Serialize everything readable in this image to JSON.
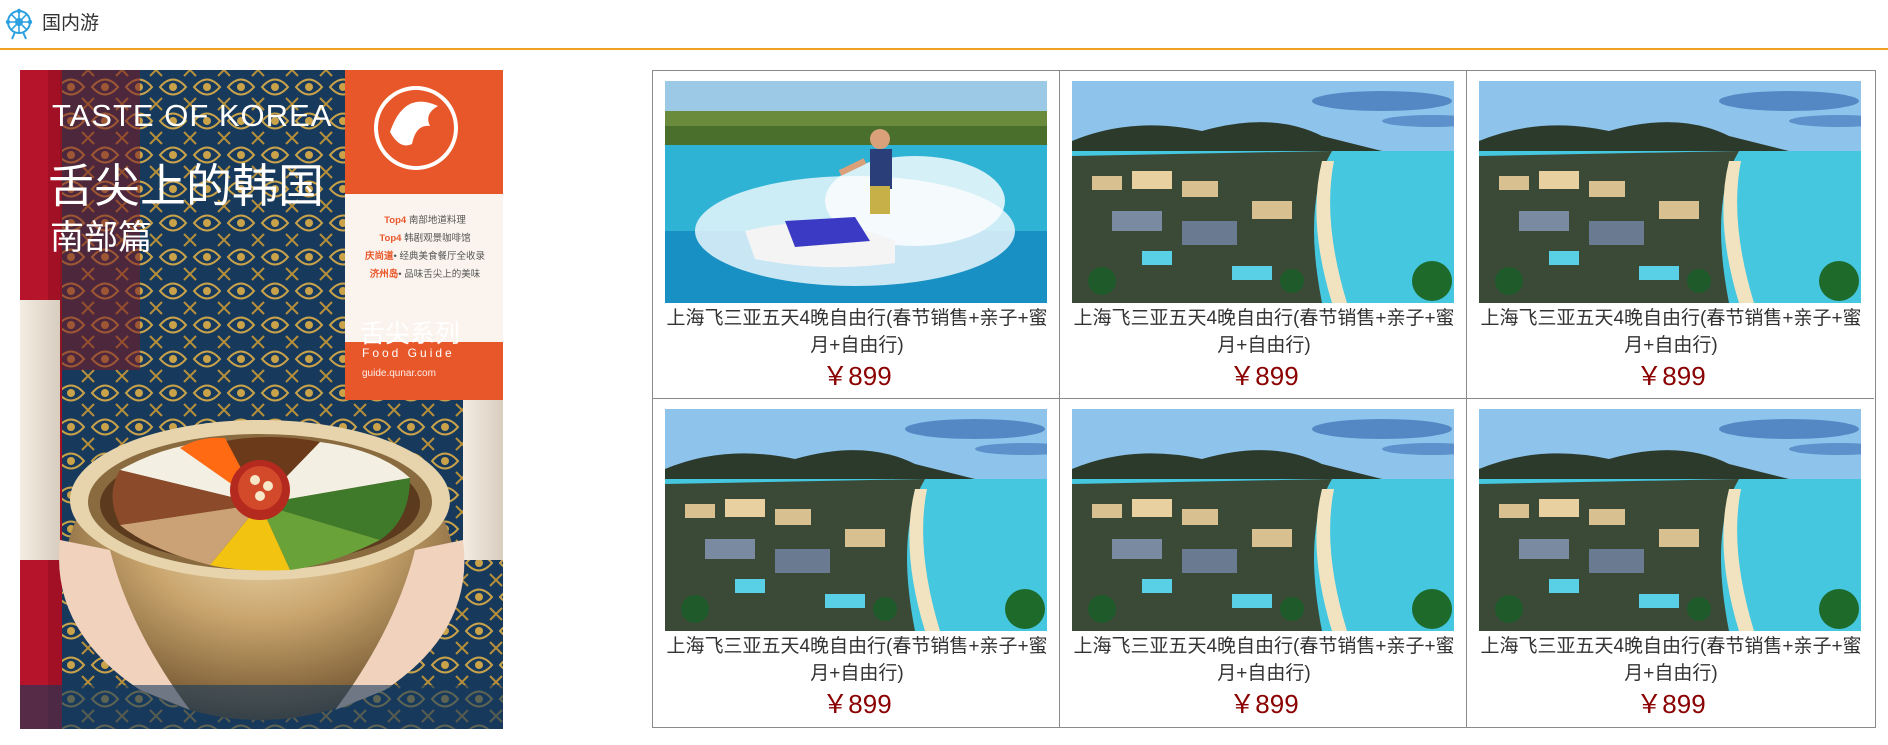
{
  "header": {
    "title": "国内游",
    "accent_color": "#f0a020",
    "logo_icon": "ferris-wheel-icon"
  },
  "banner": {
    "headline_en": "TASTE OF KOREA",
    "headline_cn": "舌尖上的韩国",
    "subtitle": "南部篇",
    "lines": [
      {
        "tag": "Top4",
        "text": "南部地道料理"
      },
      {
        "tag": "Top4",
        "text": "韩剧观景咖啡馆"
      },
      {
        "tag": "庆尚道",
        "text": "• 经典美食餐厅全收录"
      },
      {
        "tag": "济州岛",
        "text": "• 品味舌尖上的美味"
      }
    ],
    "series_cn": "舌尖系列",
    "series_en": "Food Guide",
    "url": "guide.qunar.com",
    "brand_color": "#e8572a"
  },
  "products": [
    {
      "name": "上海飞三亚五天4晚自由行(春节销售+亲子+蜜月+自由行)",
      "price": "￥899",
      "image": "jetski"
    },
    {
      "name": "上海飞三亚五天4晚自由行(春节销售+亲子+蜜月+自由行)",
      "price": "￥899",
      "image": "resort"
    },
    {
      "name": "上海飞三亚五天4晚自由行(春节销售+亲子+蜜月+自由行)",
      "price": "￥899",
      "image": "resort"
    },
    {
      "name": "上海飞三亚五天4晚自由行(春节销售+亲子+蜜月+自由行)",
      "price": "￥899",
      "image": "resort"
    },
    {
      "name": "上海飞三亚五天4晚自由行(春节销售+亲子+蜜月+自由行)",
      "price": "￥899",
      "image": "resort"
    },
    {
      "name": "上海飞三亚五天4晚自由行(春节销售+亲子+蜜月+自由行)",
      "price": "￥899",
      "image": "resort"
    }
  ]
}
